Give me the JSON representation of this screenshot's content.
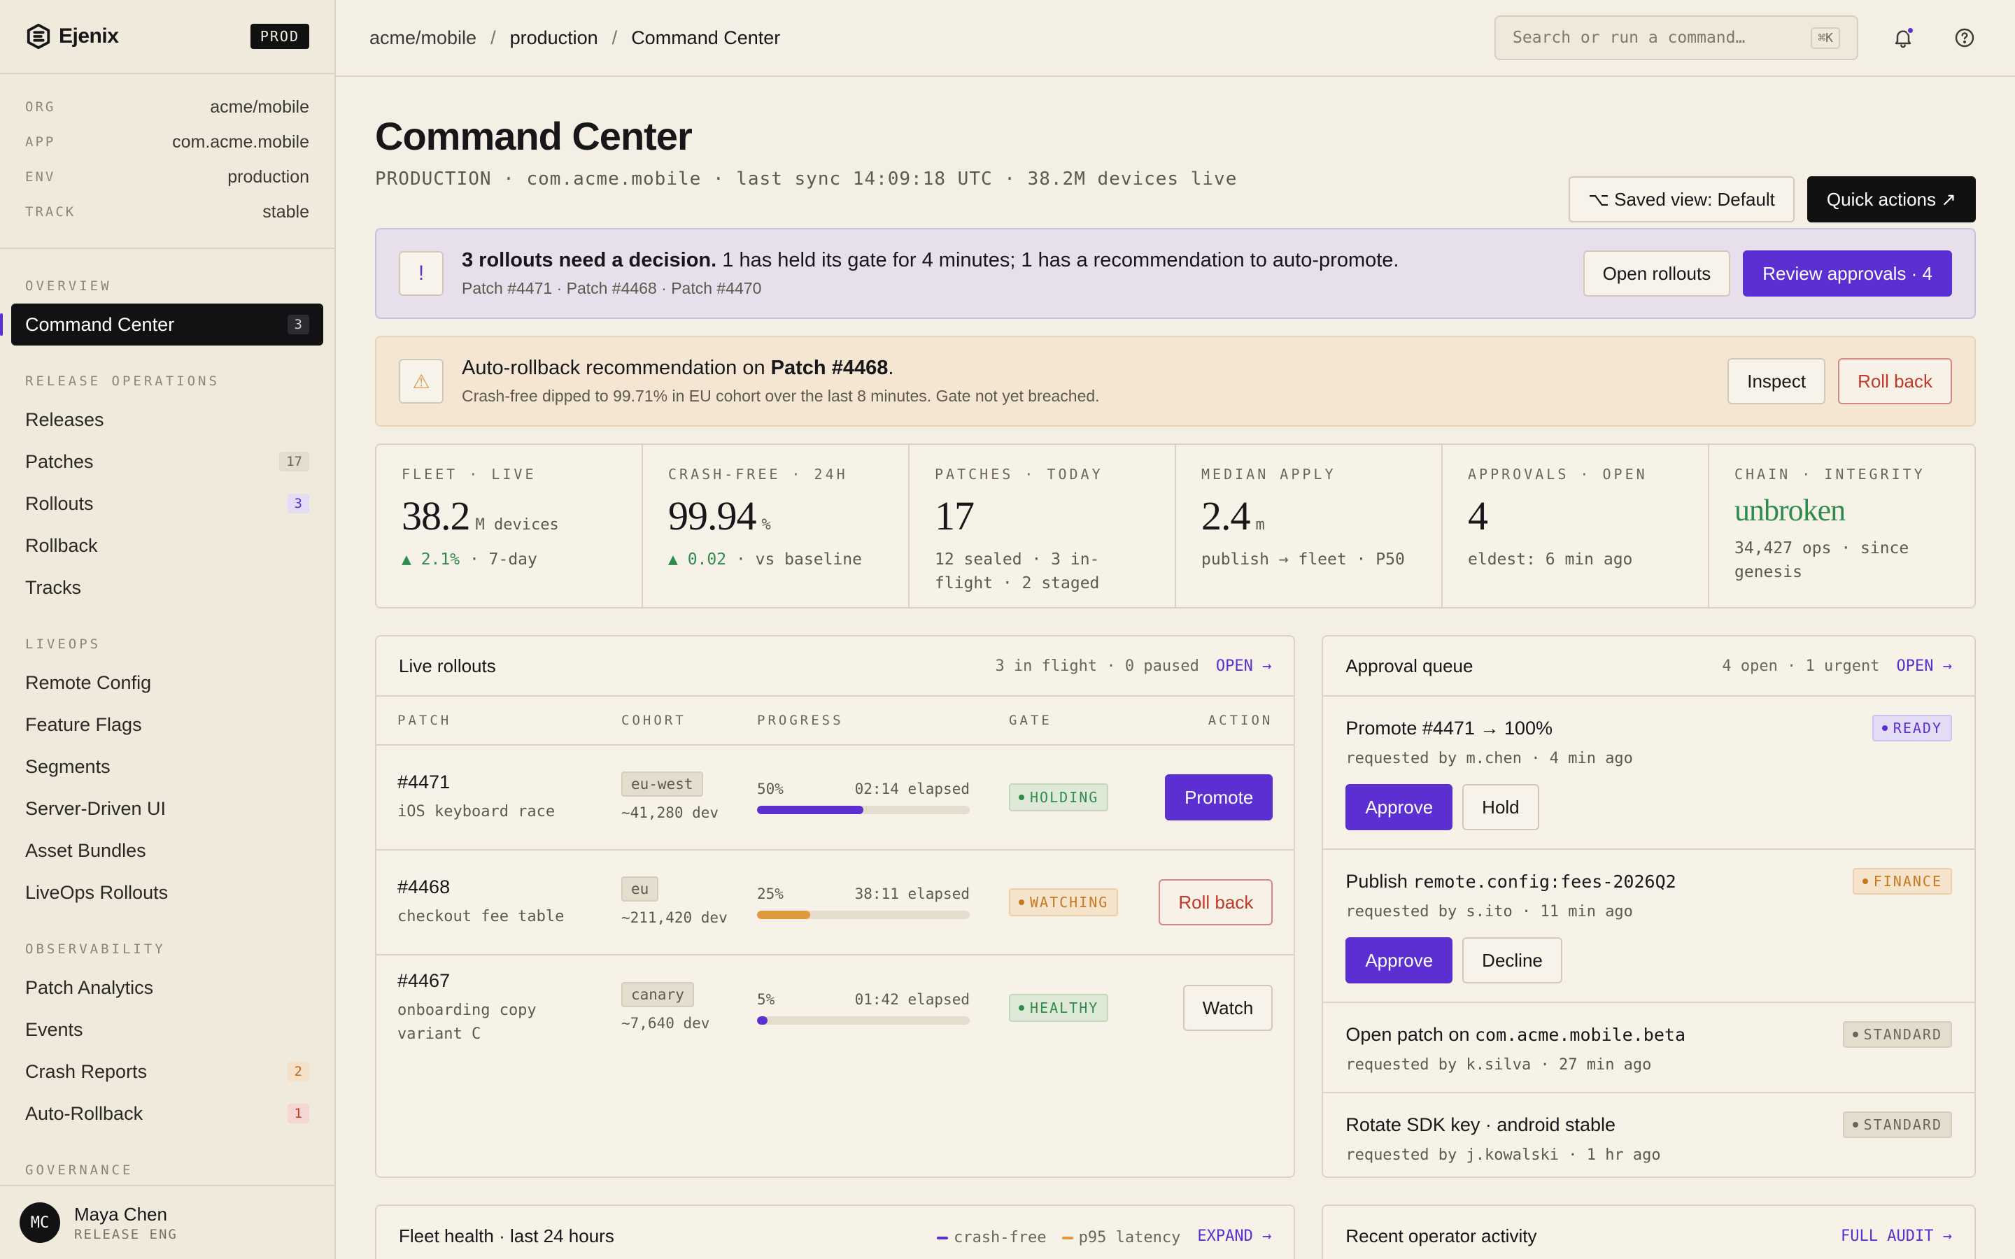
{
  "brand": {
    "name": "Ejenix",
    "env_badge": "PROD"
  },
  "context": [
    {
      "key": "ORG",
      "value": "acme/mobile"
    },
    {
      "key": "APP",
      "value": "com.acme.mobile"
    },
    {
      "key": "ENV",
      "value": "production"
    },
    {
      "key": "TRACK",
      "value": "stable"
    }
  ],
  "nav": {
    "overview_label": "OVERVIEW",
    "command_center": {
      "label": "Command Center",
      "count": "3"
    },
    "release_label": "RELEASE OPERATIONS",
    "releases": "Releases",
    "patches": {
      "label": "Patches",
      "count": "17"
    },
    "rollouts": {
      "label": "Rollouts",
      "count": "3"
    },
    "rollback": "Rollback",
    "tracks": "Tracks",
    "liveops_label": "LIVEOPS",
    "remote_config": "Remote Config",
    "feature_flags": "Feature Flags",
    "segments": "Segments",
    "server_driven_ui": "Server-Driven UI",
    "asset_bundles": "Asset Bundles",
    "liveops_rollouts": "LiveOps Rollouts",
    "observability_label": "OBSERVABILITY",
    "patch_analytics": "Patch Analytics",
    "events": "Events",
    "crash_reports": {
      "label": "Crash Reports",
      "count": "2"
    },
    "auto_rollback": {
      "label": "Auto-Rollback",
      "count": "1"
    },
    "governance_label": "GOVERNANCE"
  },
  "user": {
    "initials": "MC",
    "name": "Maya Chen",
    "role": "RELEASE ENG"
  },
  "breadcrumb": {
    "org": "acme/mobile",
    "env": "production",
    "page": "Command Center",
    "sep": "/"
  },
  "search": {
    "placeholder": "Search or run a command…",
    "shortcut": "⌘K"
  },
  "header": {
    "title": "Command Center",
    "subtitle": "PRODUCTION · com.acme.mobile · last sync 14:09:18 UTC · 38.2M devices live",
    "saved_view": "⌥ Saved view: Default",
    "quick_actions": "Quick actions ↗"
  },
  "decision_banner": {
    "icon": "!",
    "title_strong": "3 rollouts need a decision.",
    "title_rest": " 1 has held its gate for 4 minutes; 1 has a recommendation to auto-promote.",
    "sub": "Patch #4471 · Patch #4468 · Patch #4470",
    "open_rollouts": "Open rollouts",
    "review_approvals": "Review approvals · 4"
  },
  "rollback_banner": {
    "icon": "⚠",
    "title_pre": "Auto-rollback recommendation on ",
    "title_strong": "Patch #4468",
    "title_post": ".",
    "sub": "Crash-free dipped to 99.71% in EU cohort over the last 8 minutes. Gate not yet breached.",
    "inspect": "Inspect",
    "roll_back": "Roll back"
  },
  "stats": [
    {
      "label": "FLEET · LIVE",
      "value": "38.2",
      "unit": "M devices",
      "sub_up": "▲ 2.1%",
      "sub": " · 7-day"
    },
    {
      "label": "CRASH-FREE · 24H",
      "value": "99.94",
      "unit": "%",
      "sub_up": "▲ 0.02",
      "sub": " · vs baseline"
    },
    {
      "label": "PATCHES · TODAY",
      "value": "17",
      "unit": "",
      "sub_up": "",
      "sub": "12 sealed · 3 in-flight · 2 staged"
    },
    {
      "label": "MEDIAN APPLY",
      "value": "2.4",
      "unit": "m",
      "sub_up": "",
      "sub": "publish → fleet · P50"
    },
    {
      "label": "APPROVALS · OPEN",
      "value": "4",
      "unit": "",
      "sub_up": "",
      "sub": "eldest: 6 min ago"
    },
    {
      "label": "CHAIN · INTEGRITY",
      "value": "unbroken",
      "unit": "",
      "sub_up": "",
      "sub": "34,427 ops · since genesis"
    }
  ],
  "live_rollouts": {
    "title": "Live rollouts",
    "meta": "3 in flight · 0 paused",
    "open": "OPEN →",
    "columns": {
      "patch": "PATCH",
      "cohort": "COHORT",
      "progress": "PROGRESS",
      "gate": "GATE",
      "action": "ACTION"
    },
    "rows": [
      {
        "id": "#4471",
        "desc": "iOS keyboard race",
        "cohort": "eu-west",
        "devices": "~41,280 dev",
        "pct_label": "50%",
        "pct": 0.5,
        "elapsed": "02:14 elapsed",
        "gate": "HOLDING",
        "action": "Promote",
        "bar_color": "#5b2fd1"
      },
      {
        "id": "#4468",
        "desc": "checkout fee table",
        "cohort": "eu",
        "devices": "~211,420 dev",
        "pct_label": "25%",
        "pct": 0.25,
        "elapsed": "38:11 elapsed",
        "gate": "WATCHING",
        "action": "Roll back",
        "bar_color": "#e0993f"
      },
      {
        "id": "#4467",
        "desc": "onboarding copy variant C",
        "cohort": "canary",
        "devices": "~7,640 dev",
        "pct_label": "5%",
        "pct": 0.05,
        "elapsed": "01:42 elapsed",
        "gate": "HEALTHY",
        "action": "Watch",
        "bar_color": "#5b2fd1"
      }
    ]
  },
  "approval_queue": {
    "title": "Approval queue",
    "meta": "4 open · 1 urgent",
    "open": "OPEN →",
    "items": [
      {
        "title": "Promote #4471 → 100%",
        "code": "",
        "tag": "READY",
        "requested": "requested by m.chen · 4 min ago",
        "primary": "Approve",
        "secondary": "Hold"
      },
      {
        "title": "Publish ",
        "code": "remote.config:fees-2026Q2",
        "tag": "FINANCE",
        "requested": "requested by s.ito · 11 min ago",
        "primary": "Approve",
        "secondary": "Decline"
      },
      {
        "title": "Open patch on ",
        "code": "com.acme.mobile.beta",
        "tag": "STANDARD",
        "requested": "requested by k.silva · 27 min ago"
      },
      {
        "title": "Rotate SDK key · android stable",
        "code": "",
        "tag": "STANDARD",
        "requested": "requested by j.kowalski · 1 hr ago"
      }
    ]
  },
  "fleet_health": {
    "title": "Fleet health · last 24 hours",
    "legend_crash": "crash-free",
    "legend_latency": "p95 latency",
    "expand": "EXPAND →"
  },
  "recent_activity": {
    "title": "Recent operator activity",
    "full_audit": "FULL AUDIT →"
  },
  "colors": {
    "accent": "#5b2fd1",
    "warning": "#e0993f",
    "danger": "#c0392b",
    "success": "#2f8c4d"
  }
}
